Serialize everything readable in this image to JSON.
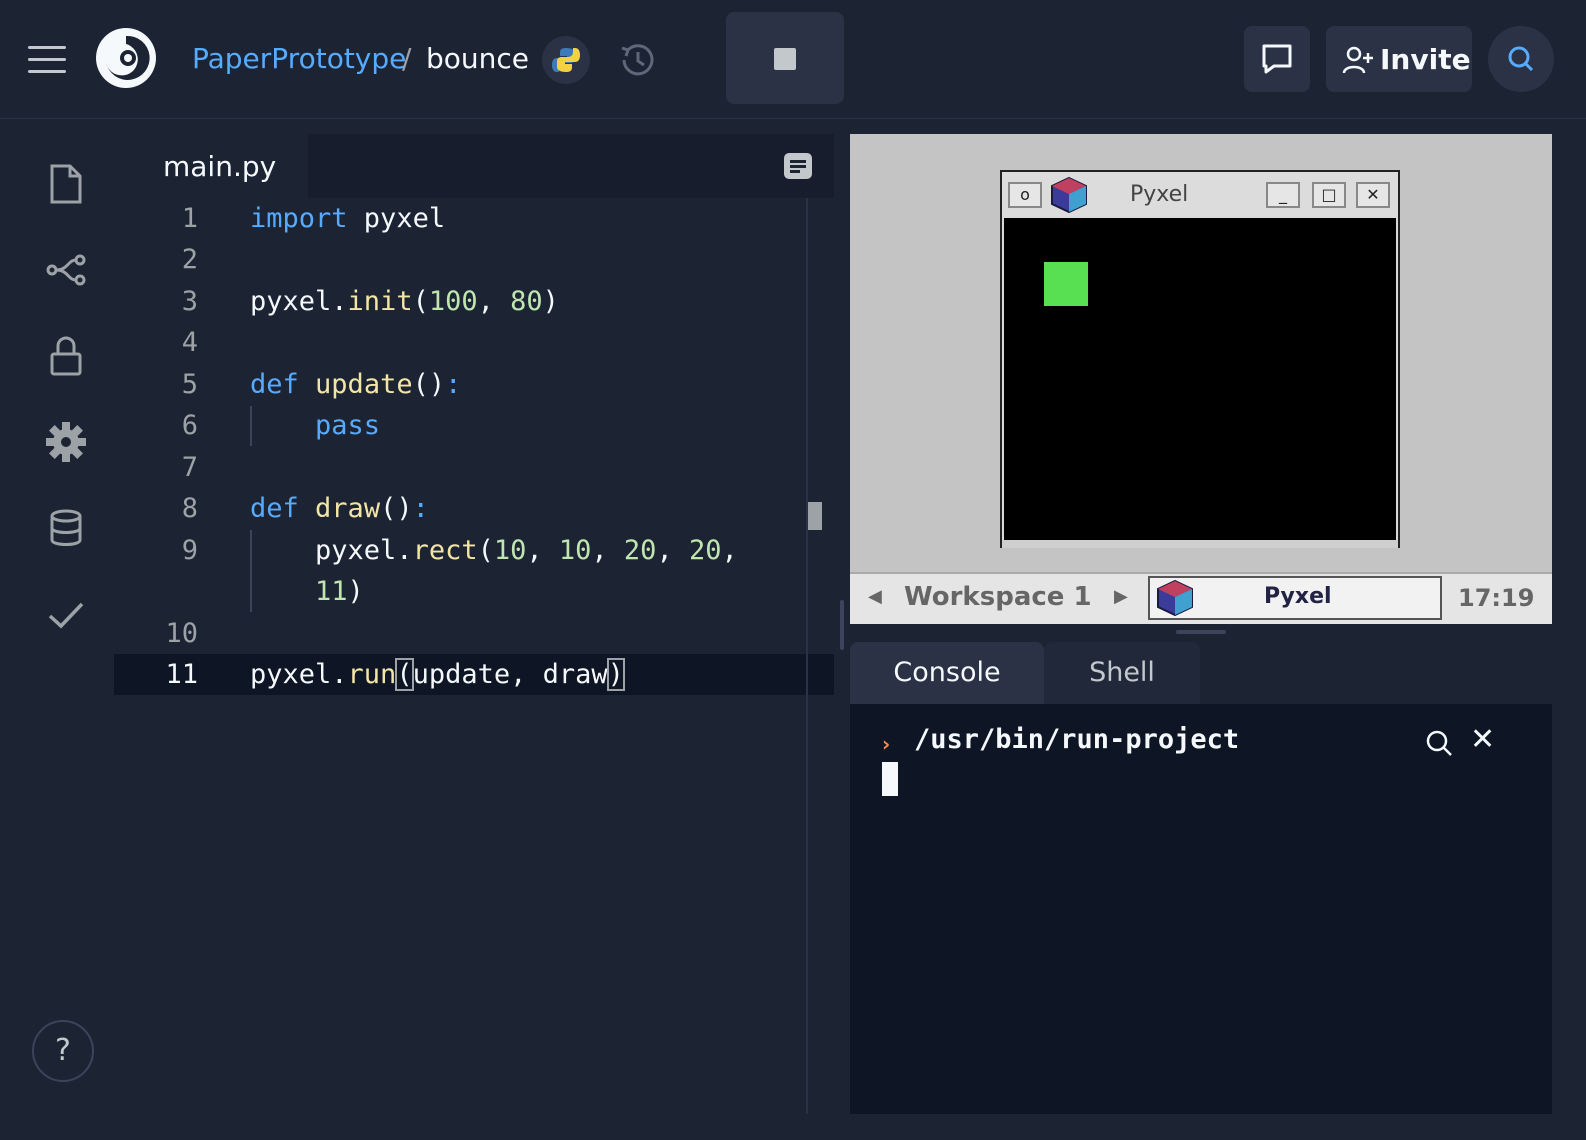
{
  "header": {
    "user": "PaperPrototype",
    "separator": "/",
    "project": "bounce",
    "invite_label": "Invite"
  },
  "sidebar": {
    "items": [
      {
        "icon": "file-icon"
      },
      {
        "icon": "git-branch-icon"
      },
      {
        "icon": "lock-icon"
      },
      {
        "icon": "gear-icon"
      },
      {
        "icon": "database-icon"
      },
      {
        "icon": "check-icon"
      }
    ],
    "help_label": "?"
  },
  "editor": {
    "tab_label": "main.py",
    "lines": [
      {
        "n": "1",
        "code": "import pyxel"
      },
      {
        "n": "2",
        "code": ""
      },
      {
        "n": "3",
        "code": "pyxel.init(100, 80)"
      },
      {
        "n": "4",
        "code": ""
      },
      {
        "n": "5",
        "code": "def update():"
      },
      {
        "n": "6",
        "code": "    pass"
      },
      {
        "n": "7",
        "code": ""
      },
      {
        "n": "8",
        "code": "def draw():"
      },
      {
        "n": "9",
        "code": "    pyxel.rect(10, 10, 20, 20,"
      },
      {
        "n": "",
        "code": "    11)"
      },
      {
        "n": "10",
        "code": ""
      },
      {
        "n": "11",
        "code": "pyxel.run(update, draw)"
      }
    ]
  },
  "preview": {
    "window_title": "Pyxel",
    "workspace_label": "Workspace 1",
    "taskbar_app": "Pyxel",
    "clock": "17:19",
    "rect_color": "#58e052"
  },
  "console": {
    "tabs": [
      "Console",
      "Shell"
    ],
    "command": "/usr/bin/run-project"
  },
  "colors": {
    "background": "#1c2333",
    "accent": "#57abff",
    "keyword": "#57abff",
    "function": "#f2e5a5",
    "number": "#bfe5b1"
  }
}
